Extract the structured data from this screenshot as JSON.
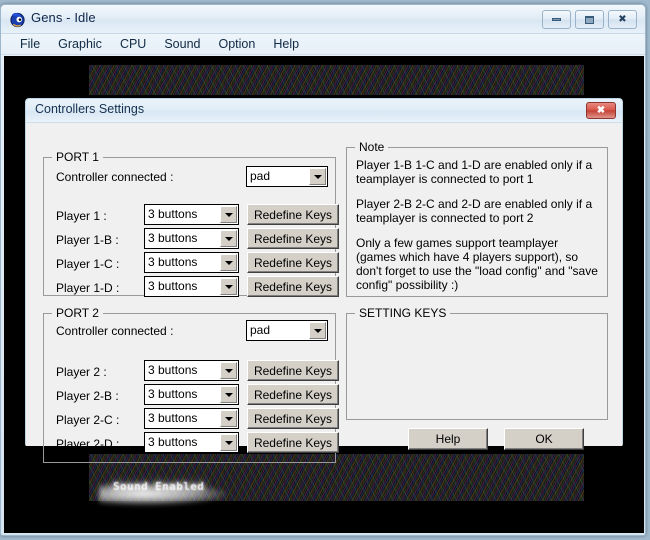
{
  "app_window": {
    "title": "Gens - Idle",
    "icon": "sonic-app-icon",
    "buttons": {
      "minimize": "minimize-icon",
      "maximize": "restore-icon",
      "close": "close-icon",
      "close_label": "✖"
    },
    "menu": [
      {
        "label": "File"
      },
      {
        "label": "Graphic"
      },
      {
        "label": "CPU"
      },
      {
        "label": "Sound"
      },
      {
        "label": "Option"
      },
      {
        "label": "Help"
      }
    ],
    "osd_text": "Sound Enabled"
  },
  "dialog": {
    "title": "Controllers Settings",
    "close_label": "✖",
    "port1": {
      "group_title": "PORT 1",
      "controller_label": "Controller connected :",
      "controller_value": "pad",
      "rows": [
        {
          "label": "Player 1    :",
          "value": "3 buttons",
          "button": "Redefine Keys"
        },
        {
          "label": "Player 1-B :",
          "value": "3 buttons",
          "button": "Redefine Keys"
        },
        {
          "label": "Player 1-C :",
          "value": "3 buttons",
          "button": "Redefine Keys"
        },
        {
          "label": "Player 1-D :",
          "value": "3 buttons",
          "button": "Redefine Keys"
        }
      ]
    },
    "port2": {
      "group_title": "PORT 2",
      "controller_label": "Controller connected :",
      "controller_value": "pad",
      "rows": [
        {
          "label": "Player 2    :",
          "value": "3 buttons",
          "button": "Redefine Keys"
        },
        {
          "label": "Player 2-B :",
          "value": "3 buttons",
          "button": "Redefine Keys"
        },
        {
          "label": "Player 2-C :",
          "value": "3 buttons",
          "button": "Redefine Keys"
        },
        {
          "label": "Player 2-D :",
          "value": "3 buttons",
          "button": "Redefine Keys"
        }
      ]
    },
    "note": {
      "group_title": "Note",
      "paragraphs": [
        "Player 1-B 1-C and 1-D are enabled only if a teamplayer is connected to port 1",
        "Player 2-B 2-C and 2-D are enabled only if a teamplayer is connected to port 2",
        "Only a few games support teamplayer (games which have 4 players support), so don't forget to use the \"load config\" and \"save config\" possibility :)"
      ]
    },
    "setting_keys": {
      "group_title": "SETTING KEYS"
    },
    "footer": {
      "help_label": "Help",
      "ok_label": "OK"
    }
  },
  "colors": {
    "dialog_face": "#f0f0f0",
    "button_face": "#d4d0c8",
    "close_red": "#c44236",
    "title_text": "#15304f"
  }
}
